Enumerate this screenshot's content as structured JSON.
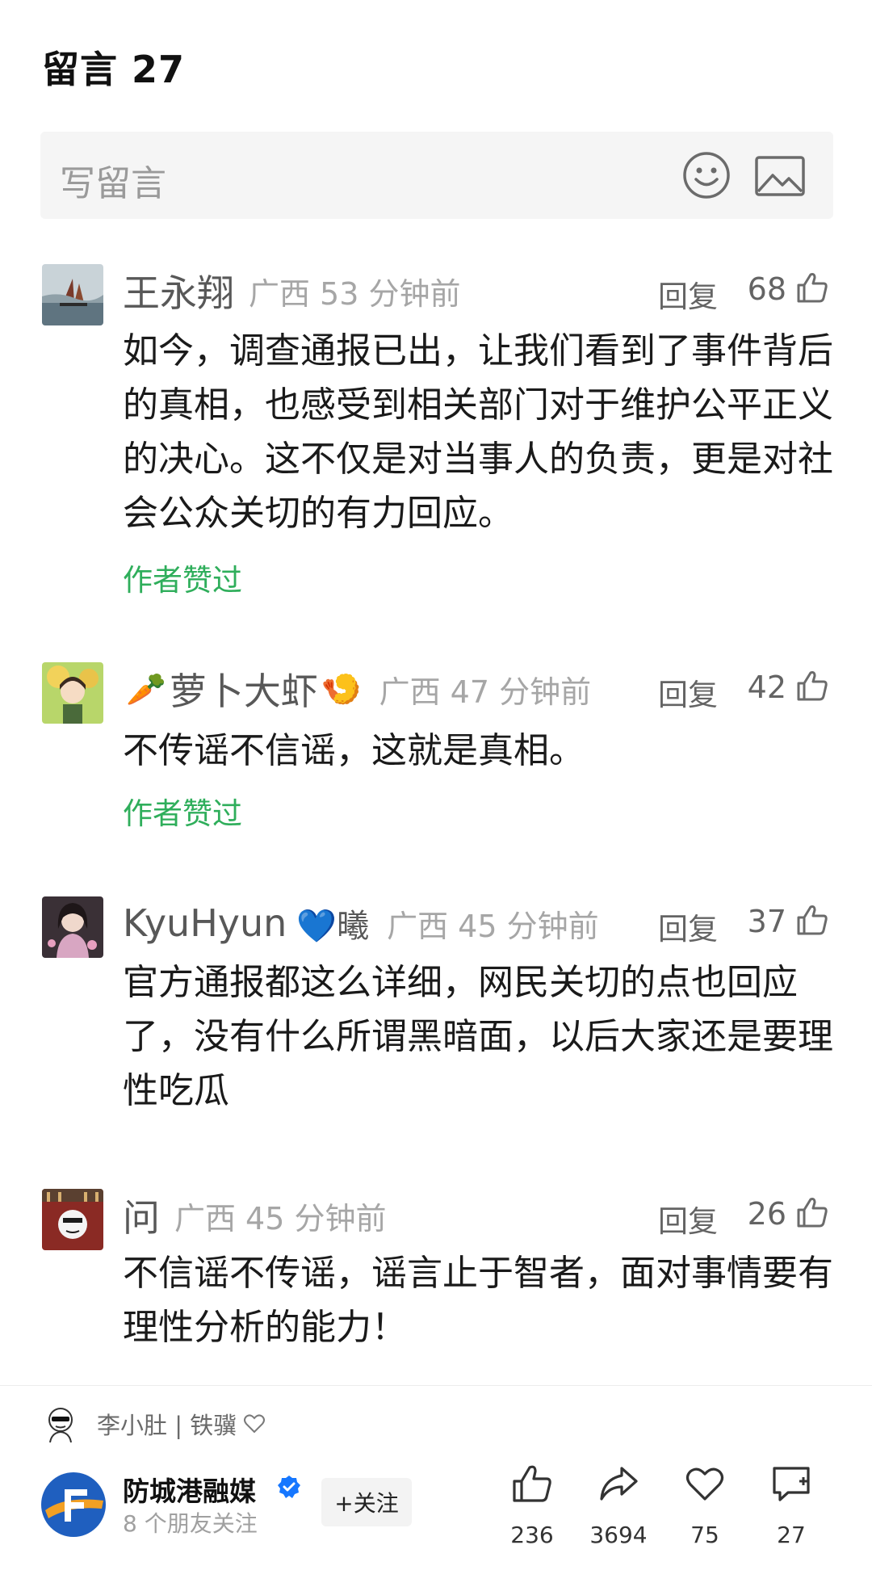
{
  "header": {
    "title": "留言 27"
  },
  "write": {
    "placeholder": "写留言"
  },
  "comments": [
    {
      "name": "王永翔",
      "name_emoji_before": "",
      "name_emoji_after": "",
      "location": "广西",
      "time": "53 分钟前",
      "reply": "回复",
      "likes": "68",
      "text": "如今，调查通报已出，让我们看到了事件背后的真相，也感受到相关部门对于维护公平正义的决心。这不仅是对当事人的负责，更是对社会公众关切的有力回应。",
      "author_liked": "作者赞过"
    },
    {
      "name": "萝卜大虾",
      "name_emoji_before": "🥕",
      "name_emoji_after": "🍤",
      "location": "广西",
      "time": "47 分钟前",
      "reply": "回复",
      "likes": "42",
      "text": "不传谣不信谣，这就是真相。",
      "author_liked": "作者赞过"
    },
    {
      "name": "KyuHyun",
      "name_emoji_before": "",
      "name_emoji_after": "💙曦",
      "location": "广西",
      "time": "45 分钟前",
      "reply": "回复",
      "likes": "37",
      "text": "官方通报都这么详细，网民关切的点也回应了，没有什么所谓黑暗面，以后大家还是要理性吃瓜",
      "author_liked": ""
    },
    {
      "name": "问",
      "name_emoji_before": "",
      "name_emoji_after": "",
      "location": "广西",
      "time": "45 分钟前",
      "reply": "回复",
      "likes": "26",
      "text": "不信谣不传谣，谣言止于智者，面对事情要有理性分析的能力！",
      "author_liked": ""
    }
  ],
  "friend_like": {
    "text": "李小肚 | 铁骥"
  },
  "account": {
    "name": "防城港融媒",
    "sub": "8 个朋友关注",
    "follow_label": "+关注"
  },
  "actions": {
    "like_count": "236",
    "share_count": "3694",
    "favorite_count": "75",
    "comment_count": "27"
  },
  "colors": {
    "liked_green": "#2fae5b",
    "brand_blue": "#1f5fbf",
    "verified_blue": "#1677ff"
  }
}
